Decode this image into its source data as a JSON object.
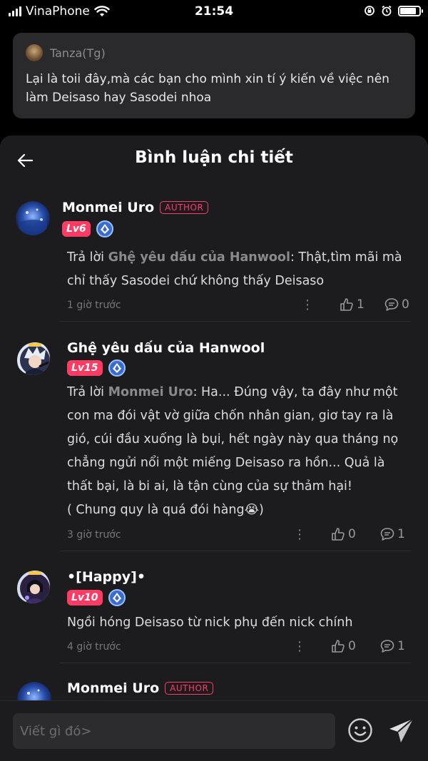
{
  "status_bar": {
    "carrier": "VinaPhone",
    "time": "21:54"
  },
  "quote": {
    "author": "Tanza(Tg)",
    "text": "Lại là toii đây,mà các bạn cho mình xin tí ý kiến về việc nên làm Deisaso hay Sasodei nhoa"
  },
  "header": {
    "title": "Bình luận chi tiết"
  },
  "comments": [
    {
      "name": "Monmei Uro",
      "author_badge": "AUTHOR",
      "level": "Lv6",
      "reply_prefix": "Trả lời ",
      "reply_to": "Ghệ yêu dấu của Hanwool",
      "text": ": Thật,tìm mãi mà chỉ thấy Sasodei chứ không thấy Deisaso",
      "time": "1 giờ trước",
      "likes": "1",
      "replies": "0"
    },
    {
      "name": "Ghệ yêu dấu của Hanwool",
      "level": "Lv15",
      "reply_prefix": "Trả lời ",
      "reply_to": "Monmei Uro",
      "text": ": Ha... Đúng vậy, ta đây như một con ma đói vật vờ giữa chốn nhân gian, giơ tay ra là gió, cúi đầu xuống là bụi, hết ngày này qua tháng nọ chẳng ngửi nổi một miếng Deisaso ra hồn... Quả là thất bại, là bi ai, là tận cùng của sự thảm hại!",
      "text_extra": "( Chung quy là quá đói hàng😭)",
      "time": "3 giờ trước",
      "likes": "0",
      "replies": "1"
    },
    {
      "name": "•[Happy]•",
      "level": "Lv10",
      "text": "Ngồi hóng Deisaso từ nick phụ đến nick chính",
      "time": "4 giờ trước",
      "likes": "0",
      "replies": "1"
    },
    {
      "name": "Monmei Uro",
      "author_badge": "AUTHOR"
    }
  ],
  "input": {
    "placeholder": "Viết gì đó>"
  },
  "colors": {
    "accent": "#ff3b63",
    "background": "#1c1c1e",
    "card": "#2a2a2c"
  },
  "icons": [
    "signal-icon",
    "wifi-icon",
    "lock-rotation-icon",
    "alarm-icon",
    "battery-icon",
    "back-arrow-icon",
    "tier-icon",
    "more-icon",
    "like-icon",
    "comment-icon",
    "emoji-icon",
    "send-icon"
  ]
}
